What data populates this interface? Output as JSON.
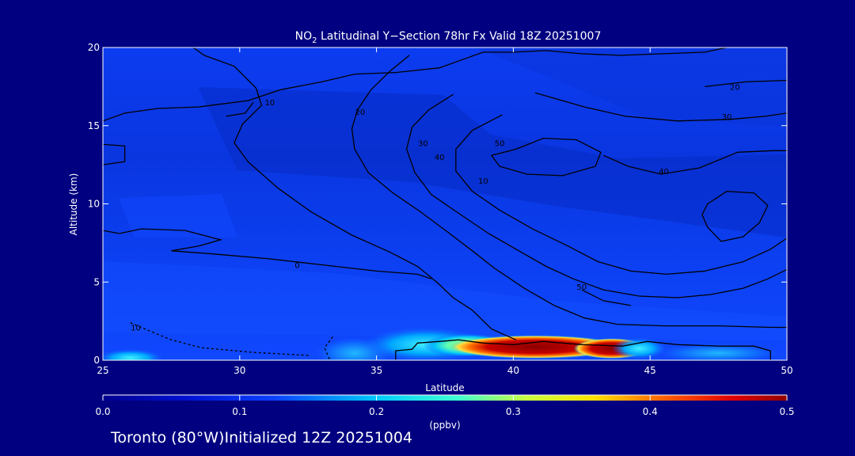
{
  "chart_data": {
    "type": "heatmap",
    "title": {
      "prefix": "NO",
      "subscript": "2",
      "rest": " Latitudinal Y−Section 78hr  Fx Valid 18Z 20251007"
    },
    "xlabel": "Latitude",
    "ylabel": "Altitude (km)",
    "xlim": [
      25,
      50
    ],
    "ylim": [
      0,
      20
    ],
    "x_ticks": [
      25,
      30,
      35,
      40,
      45,
      50
    ],
    "y_ticks": [
      0,
      5,
      10,
      15,
      20
    ],
    "colorbar": {
      "unit": "(ppbv)",
      "range": [
        0.0,
        0.5
      ],
      "ticks": [
        "0.0",
        "0.1",
        "0.2",
        "0.3",
        "0.4",
        "0.5"
      ]
    },
    "colors": {
      "background": "#000080",
      "field_base": "#0a3ff0",
      "field_dark": "#0a2fc8",
      "contour": "#000000",
      "hotspot": "#8b0000"
    },
    "no2_hotspots": [
      {
        "x": 26.0,
        "y": 0.15,
        "rx": 1.2,
        "ry": 0.55,
        "value": 0.15
      },
      {
        "x": 34.2,
        "y": 0.45,
        "rx": 1.4,
        "ry": 1.0,
        "value": 0.1
      },
      {
        "x": 36.8,
        "y": 1.0,
        "rx": 2.3,
        "ry": 1.1,
        "value": 0.2
      },
      {
        "x": 38.3,
        "y": 0.95,
        "rx": 1.6,
        "ry": 0.75,
        "value": 0.3
      },
      {
        "x": 40.8,
        "y": 0.85,
        "rx": 3.2,
        "ry": 0.75,
        "value": 0.45
      },
      {
        "x": 43.6,
        "y": 0.75,
        "rx": 1.4,
        "ry": 0.65,
        "value": 0.45
      },
      {
        "x": 44.6,
        "y": 0.75,
        "rx": 1.0,
        "ry": 0.7,
        "value": 0.2
      },
      {
        "x": 47.5,
        "y": 0.45,
        "rx": 2.2,
        "ry": 0.6,
        "value": 0.1
      }
    ],
    "contours": [
      {
        "label": "0",
        "label_at": [
          32.1,
          5.9
        ],
        "points": [
          [
            25.0,
            8.3
          ],
          [
            25.6,
            8.1
          ],
          [
            26.4,
            8.4
          ],
          [
            28.0,
            8.3
          ],
          [
            29.3,
            7.7
          ],
          [
            28.5,
            7.3
          ],
          [
            27.5,
            7.0
          ],
          [
            29.0,
            6.8
          ],
          [
            31.0,
            6.5
          ],
          [
            33.0,
            6.1
          ],
          [
            35.0,
            5.7
          ],
          [
            36.5,
            5.5
          ],
          [
            37.0,
            5.2
          ]
        ]
      },
      {
        "label": "10",
        "label_at": [
          38.9,
          11.3
        ],
        "points": [
          [
            25.0,
            15.3
          ],
          [
            25.8,
            15.8
          ],
          [
            27.0,
            16.1
          ],
          [
            28.5,
            16.2
          ],
          [
            30.3,
            16.6
          ],
          [
            31.5,
            17.3
          ],
          [
            33.0,
            17.8
          ],
          [
            34.2,
            18.3
          ],
          [
            35.7,
            18.4
          ],
          [
            37.3,
            18.7
          ],
          [
            38.1,
            19.2
          ],
          [
            38.9,
            19.7
          ],
          [
            40.0,
            19.7
          ],
          [
            41.2,
            19.8
          ],
          [
            42.5,
            19.6
          ],
          [
            43.9,
            19.5
          ],
          [
            45.5,
            19.6
          ],
          [
            47.0,
            19.7
          ],
          [
            47.8,
            20.0
          ]
        ]
      },
      {
        "label": "10",
        "label_at": [
          31.1,
          16.3
        ],
        "points": [
          [
            28.3,
            20.0
          ],
          [
            28.7,
            19.5
          ],
          [
            29.8,
            18.8
          ],
          [
            30.6,
            17.4
          ],
          [
            30.8,
            16.3
          ],
          [
            30.1,
            15.1
          ],
          [
            29.8,
            13.9
          ],
          [
            30.3,
            12.7
          ],
          [
            31.4,
            11.0
          ],
          [
            32.6,
            9.5
          ],
          [
            34.1,
            8.0
          ],
          [
            35.5,
            6.9
          ],
          [
            36.5,
            6.0
          ],
          [
            37.2,
            5.0
          ],
          [
            37.8,
            4.0
          ],
          [
            38.5,
            3.2
          ],
          [
            39.2,
            2.0
          ],
          [
            40.1,
            1.3
          ]
        ]
      },
      {
        "label": "20",
        "label_at": [
          34.4,
          15.7
        ],
        "points": [
          [
            36.2,
            19.5
          ],
          [
            35.5,
            18.5
          ],
          [
            34.8,
            17.3
          ],
          [
            34.3,
            16.0
          ],
          [
            34.1,
            14.8
          ],
          [
            34.2,
            13.5
          ],
          [
            34.7,
            12.0
          ],
          [
            35.6,
            10.7
          ],
          [
            36.6,
            9.5
          ],
          [
            37.6,
            8.2
          ],
          [
            38.5,
            7.0
          ],
          [
            39.3,
            5.9
          ],
          [
            40.4,
            4.6
          ],
          [
            41.5,
            3.5
          ],
          [
            42.6,
            2.7
          ],
          [
            43.8,
            2.3
          ],
          [
            45.5,
            2.2
          ],
          [
            47.5,
            2.2
          ],
          [
            49.4,
            2.1
          ],
          [
            50.0,
            2.1
          ]
        ]
      },
      {
        "label": "20",
        "label_at": [
          48.1,
          17.3
        ],
        "points": [
          [
            47.0,
            17.5
          ],
          [
            48.5,
            17.8
          ],
          [
            50.0,
            17.9
          ]
        ]
      },
      {
        "label": "30",
        "label_at": [
          36.7,
          13.7
        ],
        "points": [
          [
            37.8,
            17.0
          ],
          [
            36.9,
            16.0
          ],
          [
            36.3,
            14.9
          ],
          [
            36.1,
            13.5
          ],
          [
            36.4,
            12.0
          ],
          [
            37.0,
            10.6
          ],
          [
            38.0,
            9.4
          ],
          [
            39.1,
            8.1
          ],
          [
            40.2,
            7.0
          ],
          [
            41.2,
            6.0
          ],
          [
            42.2,
            5.2
          ],
          [
            43.3,
            4.5
          ],
          [
            44.6,
            4.1
          ],
          [
            46.0,
            4.0
          ],
          [
            47.2,
            4.2
          ],
          [
            48.4,
            4.6
          ],
          [
            49.3,
            5.2
          ],
          [
            50.0,
            5.8
          ]
        ]
      },
      {
        "label": "30",
        "label_at": [
          47.8,
          15.4
        ],
        "points": [
          [
            40.8,
            17.1
          ],
          [
            42.6,
            16.2
          ],
          [
            44.1,
            15.6
          ],
          [
            46.0,
            15.3
          ],
          [
            47.9,
            15.4
          ],
          [
            49.2,
            15.6
          ],
          [
            50.0,
            15.8
          ]
        ]
      },
      {
        "label": "40",
        "label_at": [
          37.3,
          12.8
        ],
        "points": [
          [
            39.6,
            15.7
          ],
          [
            38.5,
            14.7
          ],
          [
            37.9,
            13.5
          ],
          [
            37.9,
            12.1
          ],
          [
            38.5,
            10.8
          ],
          [
            39.5,
            9.6
          ],
          [
            40.7,
            8.4
          ],
          [
            42.0,
            7.3
          ],
          [
            43.1,
            6.3
          ],
          [
            44.3,
            5.7
          ],
          [
            45.6,
            5.5
          ],
          [
            47.0,
            5.7
          ],
          [
            48.4,
            6.3
          ],
          [
            49.4,
            7.1
          ],
          [
            50.0,
            7.8
          ]
        ]
      },
      {
        "label": "40",
        "label_at": [
          45.5,
          11.9
        ],
        "points": [
          [
            43.3,
            13.1
          ],
          [
            44.2,
            12.4
          ],
          [
            45.4,
            11.9
          ],
          [
            46.8,
            12.3
          ],
          [
            48.2,
            13.3
          ],
          [
            49.5,
            13.4
          ],
          [
            50.0,
            13.4
          ]
        ]
      },
      {
        "label": "50",
        "label_at": [
          39.5,
          13.7
        ],
        "points": [
          [
            40.1,
            13.5
          ],
          [
            41.1,
            14.2
          ],
          [
            42.3,
            14.1
          ],
          [
            43.2,
            13.3
          ],
          [
            43.0,
            12.4
          ],
          [
            41.8,
            11.8
          ],
          [
            40.5,
            11.9
          ],
          [
            39.5,
            12.4
          ],
          [
            39.2,
            13.1
          ],
          [
            40.1,
            13.5
          ]
        ]
      },
      {
        "label": "50",
        "label_at": [
          42.5,
          4.5
        ],
        "points": [
          [
            42.5,
            4.5
          ],
          [
            43.3,
            3.8
          ],
          [
            44.3,
            3.5
          ]
        ]
      },
      {
        "label": "",
        "label_at": null,
        "points": [
          [
            47.1,
            10.0
          ],
          [
            47.8,
            10.8
          ],
          [
            48.8,
            10.7
          ],
          [
            49.3,
            9.9
          ],
          [
            49.0,
            8.8
          ],
          [
            48.4,
            7.9
          ],
          [
            47.6,
            7.6
          ],
          [
            47.1,
            8.5
          ],
          [
            46.9,
            9.3
          ],
          [
            47.1,
            10.0
          ]
        ]
      },
      {
        "label": "",
        "label_at": null,
        "points": [
          [
            25.0,
            12.5
          ],
          [
            25.8,
            12.7
          ],
          [
            25.8,
            13.7
          ],
          [
            25.0,
            13.8
          ]
        ]
      },
      {
        "label": "",
        "label_at": null,
        "points": [
          [
            30.5,
            16.5
          ],
          [
            30.2,
            15.8
          ],
          [
            29.5,
            15.6
          ]
        ]
      }
    ],
    "dashed_contours": [
      {
        "label": "10",
        "label_at": [
          26.2,
          1.9
        ],
        "points": [
          [
            26.0,
            2.4
          ],
          [
            26.8,
            1.8
          ],
          [
            27.5,
            1.3
          ],
          [
            28.6,
            0.8
          ],
          [
            30.5,
            0.5
          ],
          [
            32.6,
            0.3
          ]
        ]
      },
      {
        "label": "",
        "label_at": null,
        "points": [
          [
            33.4,
            1.5
          ],
          [
            33.1,
            0.8
          ],
          [
            33.3,
            0.0
          ]
        ]
      }
    ],
    "terrain_outline": [
      [
        35.7,
        0.0
      ],
      [
        35.7,
        0.6
      ],
      [
        36.3,
        0.7
      ],
      [
        36.5,
        1.1
      ],
      [
        37.3,
        1.2
      ],
      [
        38.0,
        1.3
      ],
      [
        38.9,
        1.1
      ],
      [
        40.0,
        1.0
      ],
      [
        41.1,
        1.2
      ],
      [
        42.5,
        1.0
      ],
      [
        44.0,
        0.9
      ],
      [
        44.9,
        1.2
      ],
      [
        46.0,
        1.0
      ],
      [
        47.5,
        0.9
      ],
      [
        48.8,
        0.9
      ],
      [
        49.4,
        0.6
      ],
      [
        49.4,
        0.0
      ]
    ],
    "footer_location": "Toronto (80°W)",
    "footer_initialized": "Initialized 12Z 20251004"
  }
}
